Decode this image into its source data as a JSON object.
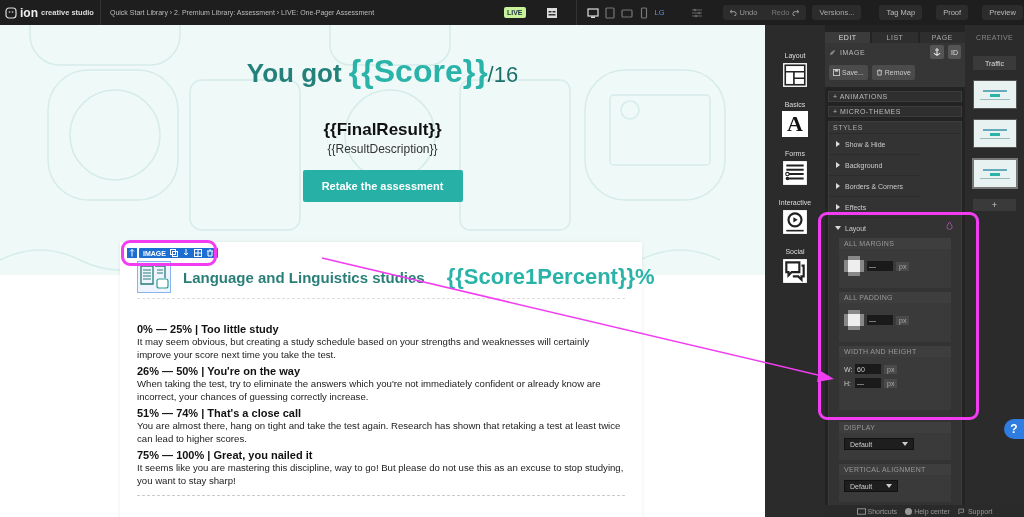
{
  "topbar": {
    "logo": "ion",
    "brand": "creative studio",
    "breadcrumb": "Quick Start Library › 2. Premium Library: Assessment › LIVE: One-Pager Assessment",
    "live": "LIVE",
    "size_label": "LG",
    "undo": "Undo",
    "redo": "Redo",
    "versions": "Versions...",
    "tag_map": "Tag Map",
    "proof": "Proof",
    "preview": "Preview"
  },
  "hero": {
    "title_prefix": "You got",
    "score": "{{Score}}",
    "title_suffix": "/16",
    "final_result": "{{FinalResult}}",
    "description": "{{ResultDescription}}",
    "button": "Retake the assessment"
  },
  "card": {
    "toolbar_label": "IMAGE",
    "heading": "Language and Linguistics studies",
    "score_percent": "{{Score1Percent}}%",
    "ranges": [
      {
        "title": "0% — 25% | Too little study",
        "text": "It may seem obvious, but creating a study schedule based on your strengths and weaknesses will certainly improve your score next time you take the test."
      },
      {
        "title": "26% — 50% | You're on the way",
        "text": "When taking the test, try to eliminate the answers which you're not immediately confident or already know are incorrect, your chances of guessing correctly increase."
      },
      {
        "title": "51% — 74% | That's a close call",
        "text": "You are almost there, hang on tight and take the test again. Research has shown that retaking a test at least twice can lead to higher scores."
      },
      {
        "title": "75% — 100% | Great, you nailed it",
        "text": "It seems like you are mastering this discipline, way to go! But please do not use this as an excuse to stop studying, you want to stay sharp!"
      }
    ]
  },
  "tools": [
    {
      "kind": "layout",
      "label": "Layout"
    },
    {
      "kind": "basics",
      "label": "Basics",
      "glyph": "A"
    },
    {
      "kind": "forms",
      "label": "Forms"
    },
    {
      "kind": "interactive",
      "label": "Interactive"
    },
    {
      "kind": "social",
      "label": "Social"
    }
  ],
  "panel": {
    "tabs": [
      {
        "label": "EDIT",
        "selected": true
      },
      {
        "label": "LIST",
        "selected": false
      },
      {
        "label": "PAGE",
        "selected": false
      }
    ],
    "element_type": "IMAGE",
    "id_button": "ID",
    "save": "Save...",
    "remove": "Remove",
    "collapsibles": [
      "+ ANIMATIONS",
      "+ MICRO-THEMES"
    ],
    "styles_header": "STYLES",
    "style_sections": [
      {
        "label": "Show & Hide",
        "expanded": false
      },
      {
        "label": "Background",
        "expanded": false
      },
      {
        "label": "Borders & Corners",
        "expanded": false
      },
      {
        "label": "Effects",
        "expanded": false
      },
      {
        "label": "Layout",
        "expanded": true
      }
    ],
    "margins": {
      "title": "ALL MARGINS",
      "value": "—",
      "unit": "px"
    },
    "padding": {
      "title": "ALL PADDING",
      "value": "—",
      "unit": "px"
    },
    "size": {
      "title": "WIDTH AND HEIGHT",
      "w_label": "W:",
      "w_value": "60",
      "w_unit": "px",
      "h_label": "H:",
      "h_value": "—",
      "h_unit": "px"
    },
    "display": {
      "title": "DISPLAY",
      "value": "Default"
    },
    "vertical_alignment": {
      "title": "VERTICAL ALIGNMENT",
      "value": "Default"
    }
  },
  "creative": {
    "tab": "CREATIVE",
    "traffic": "Traffic",
    "pages": [
      {
        "selected": false
      },
      {
        "selected": false
      },
      {
        "selected": true
      }
    ],
    "add": "+"
  },
  "footer": {
    "shortcuts": "Shortcuts",
    "help_center": "Help center",
    "support": "Support"
  },
  "help": "?"
}
